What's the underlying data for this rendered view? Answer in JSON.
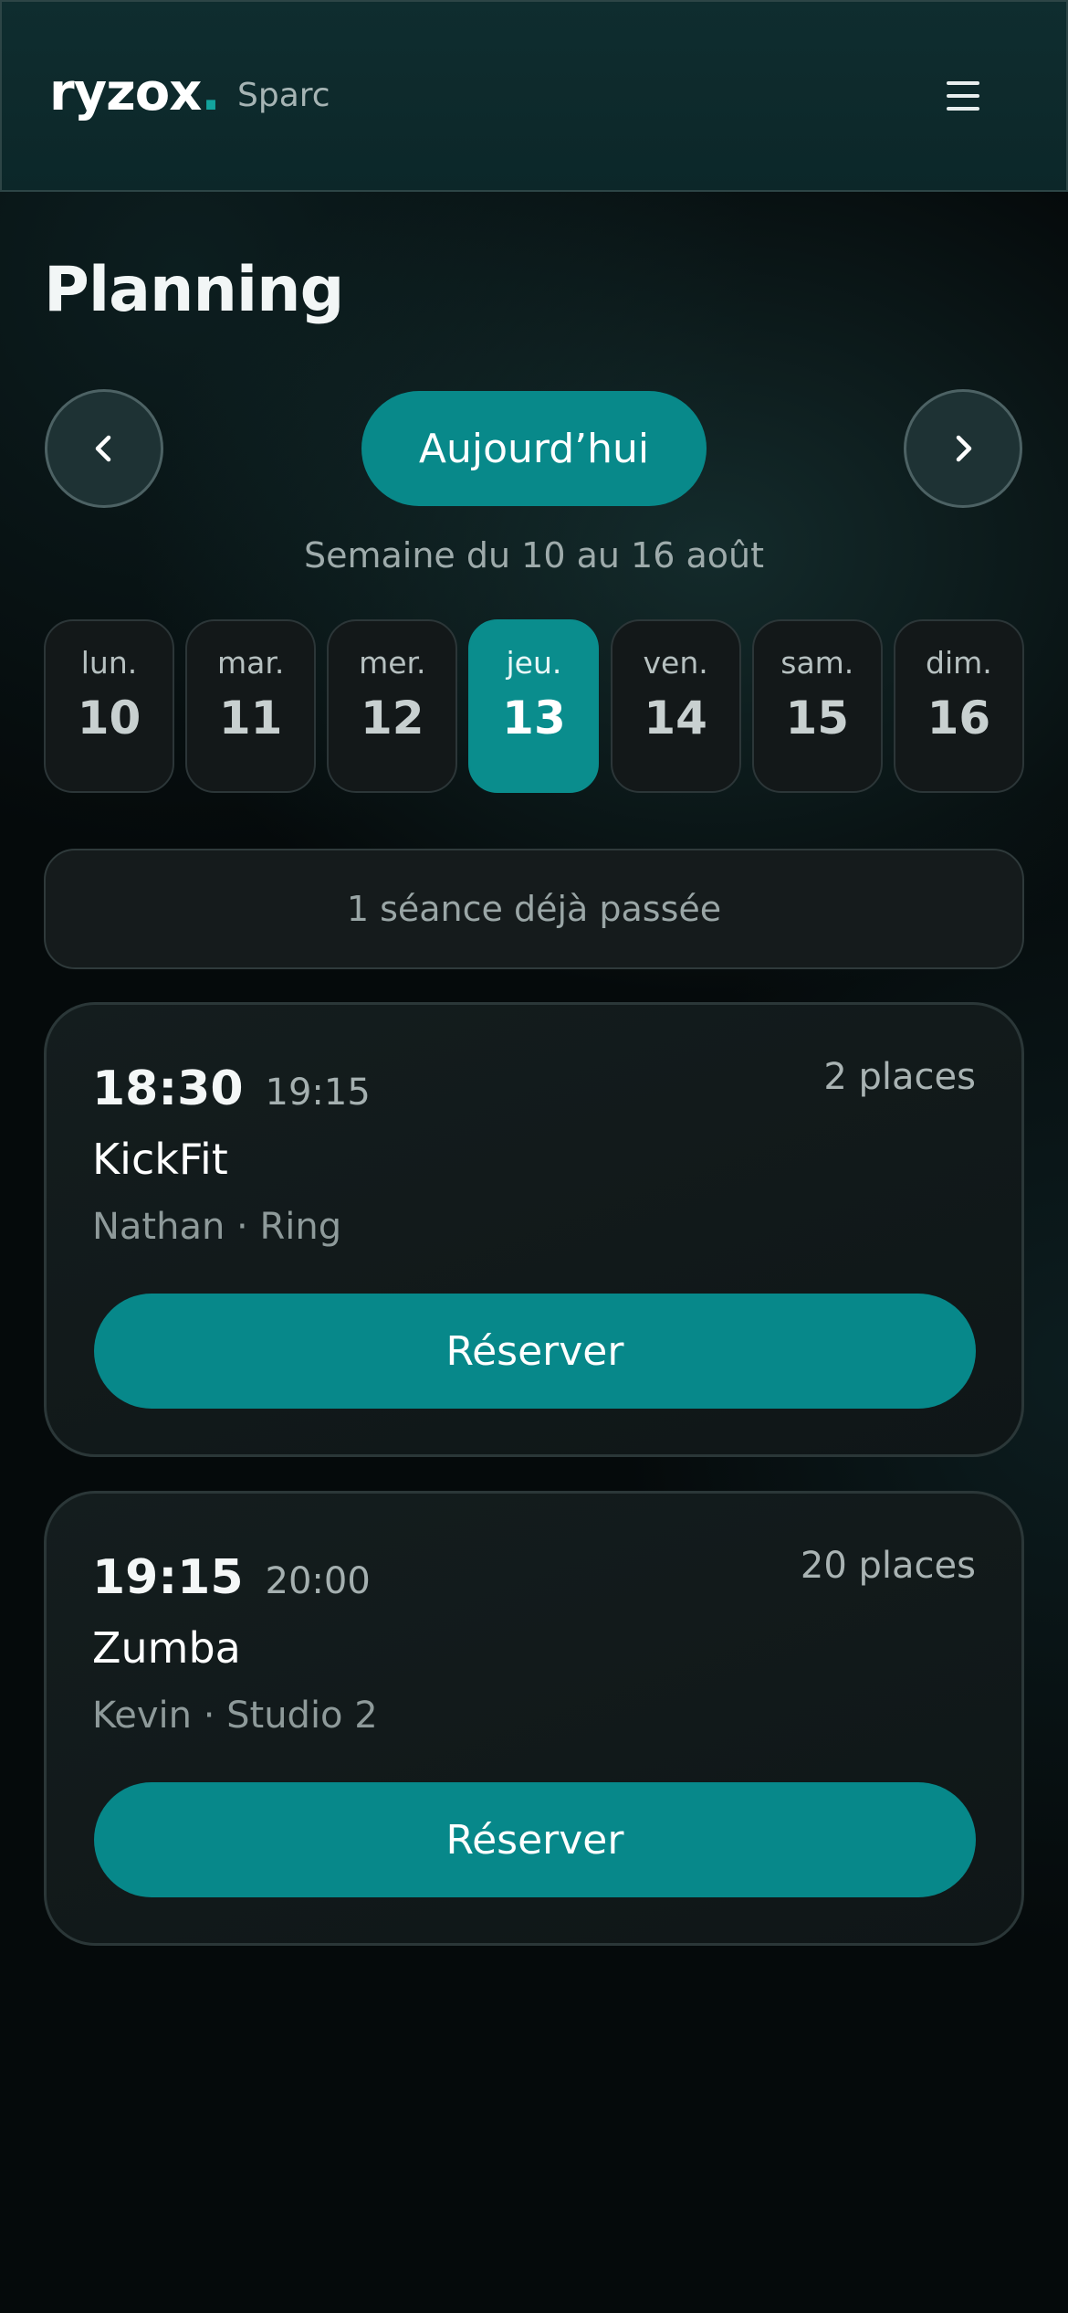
{
  "header": {
    "logo_text": "ryzox",
    "logo_dot": ".",
    "club_name": "Sparc",
    "menu_icon": "hamburger-menu-icon"
  },
  "page": {
    "title": "Planning"
  },
  "week_nav": {
    "prev_icon": "chevron-left-icon",
    "next_icon": "chevron-right-icon",
    "today_label": "Aujourd’hui",
    "week_label": "Semaine du 10 au 16 août"
  },
  "days": [
    {
      "name": "lun.",
      "number": "10",
      "selected": false
    },
    {
      "name": "mar.",
      "number": "11",
      "selected": false
    },
    {
      "name": "mer.",
      "number": "12",
      "selected": false
    },
    {
      "name": "jeu.",
      "number": "13",
      "selected": true
    },
    {
      "name": "ven.",
      "number": "14",
      "selected": false
    },
    {
      "name": "sam.",
      "number": "15",
      "selected": false
    },
    {
      "name": "dim.",
      "number": "16",
      "selected": false
    }
  ],
  "past_sessions_label": "1 séance déjà passée",
  "sessions": [
    {
      "start": "18:30",
      "end": "19:15",
      "places": "2 places",
      "name": "KickFit",
      "meta": "Nathan · Ring",
      "button": "Réserver"
    },
    {
      "start": "19:15",
      "end": "20:00",
      "places": "20 places",
      "name": "Zumba",
      "meta": "Kevin · Studio 2",
      "button": "Réserver"
    }
  ],
  "colors": {
    "accent": "#08898a",
    "background": "#050a0b",
    "header": "#0f2d2f"
  }
}
